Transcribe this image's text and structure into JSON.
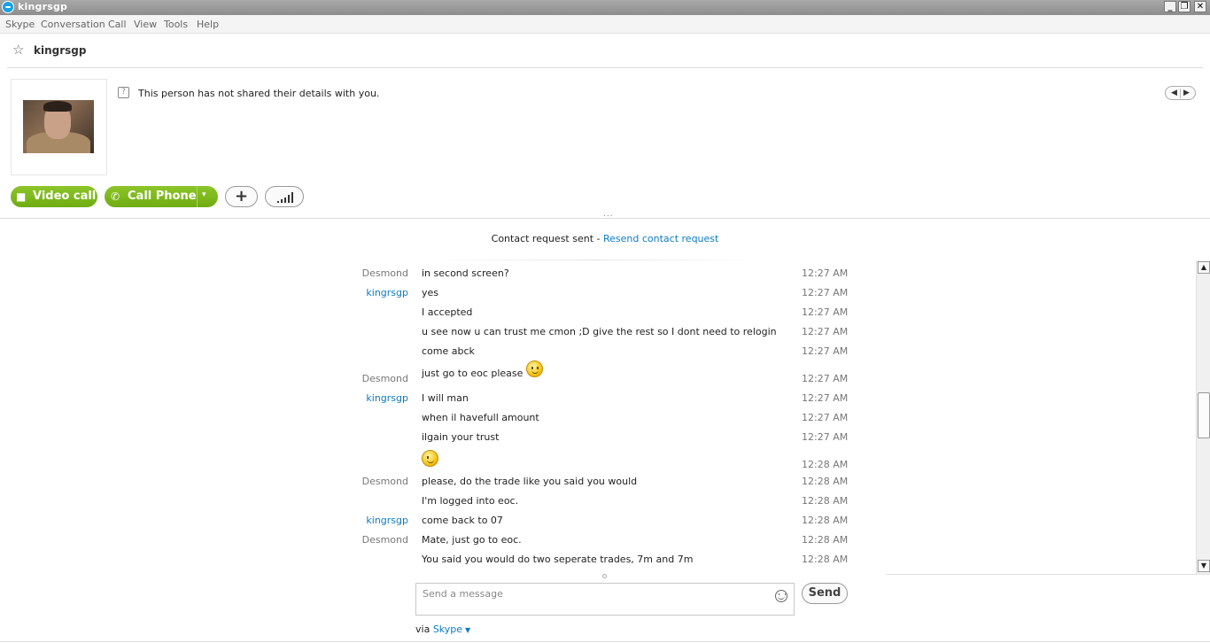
{
  "window": {
    "title": "kingrsgp",
    "controls": {
      "minimize": "_",
      "maximize": "❐",
      "close": "✕"
    }
  },
  "menu": [
    "Skype",
    "Conversation",
    "Call",
    "View",
    "Tools",
    "Help"
  ],
  "contact": {
    "name": "kingrsgp",
    "details_notice": "This person has not shared their details with you."
  },
  "actions": {
    "video_call": "Video call",
    "call_phone": "Call Phone",
    "add_icon": "+",
    "dropdown_caret": "▾"
  },
  "request": {
    "text": "Contact request sent - ",
    "link": "Resend contact request"
  },
  "messages": [
    {
      "sender": "Desmond",
      "role": "other",
      "text": "in second screen?",
      "time": "12:27 AM"
    },
    {
      "sender": "kingrsgp",
      "role": "me",
      "text": "yes",
      "time": "12:27 AM"
    },
    {
      "sender": "",
      "role": "me",
      "text": "I accepted",
      "time": "12:27 AM"
    },
    {
      "sender": "",
      "role": "me",
      "text": "u see now u can trust me cmon ;D give the rest so I dont need to relogin",
      "time": "12:27 AM"
    },
    {
      "sender": "",
      "role": "me",
      "text": "come abck",
      "time": "12:27 AM"
    },
    {
      "sender": "Desmond",
      "role": "other",
      "text": "just go to eoc please",
      "emoticon": "smile",
      "time": "12:27 AM"
    },
    {
      "sender": "kingrsgp",
      "role": "me",
      "text": "I will man",
      "time": "12:27 AM"
    },
    {
      "sender": "",
      "role": "me",
      "text": "when il havefull amount",
      "time": "12:27 AM"
    },
    {
      "sender": "",
      "role": "me",
      "text": "ilgain your trust",
      "time": "12:27 AM"
    },
    {
      "sender": "",
      "role": "me",
      "text": "",
      "emoticon": "wink",
      "time": "12:28 AM"
    },
    {
      "sender": "Desmond",
      "role": "other",
      "text": "please, do the trade like you said you would",
      "time": "12:28 AM"
    },
    {
      "sender": "",
      "role": "other",
      "text": "I'm logged into eoc.",
      "time": "12:28 AM"
    },
    {
      "sender": "kingrsgp",
      "role": "me",
      "text": "come back to 07",
      "time": "12:28 AM"
    },
    {
      "sender": "Desmond",
      "role": "other",
      "text": "Mate, just go to eoc.",
      "time": "12:28 AM"
    },
    {
      "sender": "",
      "role": "other",
      "text": "You said you would do two seperate trades, 7m and 7m",
      "time": "12:28 AM"
    }
  ],
  "scrollbar": {
    "up": "▲",
    "down": "▼"
  },
  "compose": {
    "placeholder": "Send a message",
    "value": "",
    "send_label": "Send"
  },
  "footer": {
    "via_label": "via ",
    "via_link": "Skype",
    "caret": "▼"
  },
  "colors": {
    "accent_link": "#0d7bc5",
    "call_green": "#7ab51d",
    "titlebar": "#9a9a9a"
  }
}
